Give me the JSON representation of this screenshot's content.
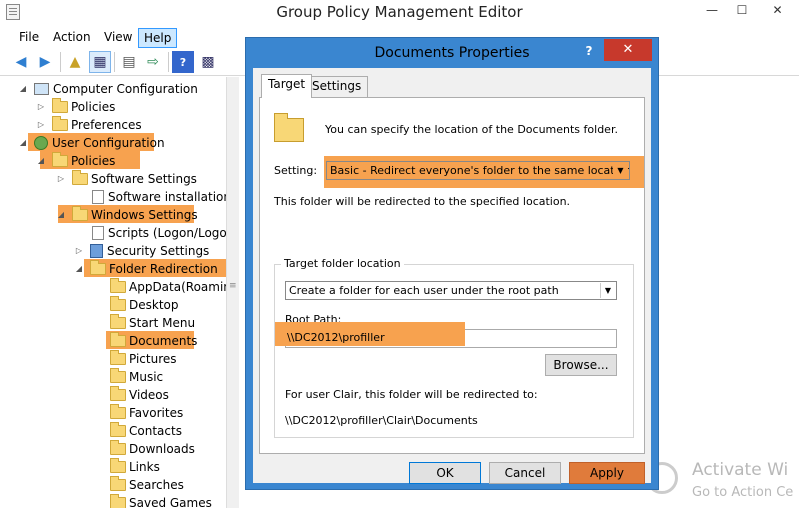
{
  "window": {
    "title": "Group Policy Management Editor",
    "controls": {
      "minimize": "—",
      "maximize": "☐",
      "close": "✕"
    }
  },
  "menu": [
    "File",
    "Action",
    "View",
    "Help"
  ],
  "menu_active": "Help",
  "toolbar": [
    "back-arrow-icon",
    "forward-arrow-icon",
    "up-folder-icon",
    "show-hide-tree-icon",
    "properties-icon",
    "export-list-icon",
    "help-icon",
    "show-pane-icon"
  ],
  "tree": {
    "computer_configuration": "Computer Configuration",
    "cc_policies": "Policies",
    "cc_preferences": "Preferences",
    "user_configuration": "User Configuration",
    "uc_policies": "Policies",
    "software_settings": "Software Settings",
    "software_installation": "Software installation",
    "windows_settings": "Windows Settings",
    "scripts": "Scripts (Logon/Logof",
    "security_settings": "Security Settings",
    "folder_redirection": "Folder Redirection",
    "folders": [
      "AppData(Roamin",
      "Desktop",
      "Start Menu",
      "Documents",
      "Pictures",
      "Music",
      "Videos",
      "Favorites",
      "Contacts",
      "Downloads",
      "Links",
      "Searches",
      "Saved Games"
    ]
  },
  "dialog": {
    "title": "Documents Properties",
    "help": "?",
    "close": "✕",
    "tabs": [
      "Target",
      "Settings"
    ],
    "intro": "You can specify the location of the Documents folder.",
    "setting_label": "Setting:",
    "setting_value": "Basic - Redirect everyone's folder to the same location",
    "redirect_note": "This folder will be redirected to the specified location.",
    "target_group_label": "Target folder location",
    "target_value": "Create a folder for each user under the root path",
    "root_path_label": "Root Path:",
    "root_path_value": "\\\\DC2012\\profiller",
    "browse": "Browse...",
    "for_user_note": "For user Clair, this folder will be redirected to:",
    "resolved_path": "\\\\DC2012\\profiller\\Clair\\Documents",
    "ok": "OK",
    "cancel": "Cancel",
    "apply": "Apply"
  },
  "watermark": {
    "title": "Activate Wi",
    "subtitle": "Go to Action Ce"
  },
  "colors": {
    "highlight": "#f7a24f",
    "dialog_frame": "#3a86d0",
    "close_button": "#c7392c"
  }
}
